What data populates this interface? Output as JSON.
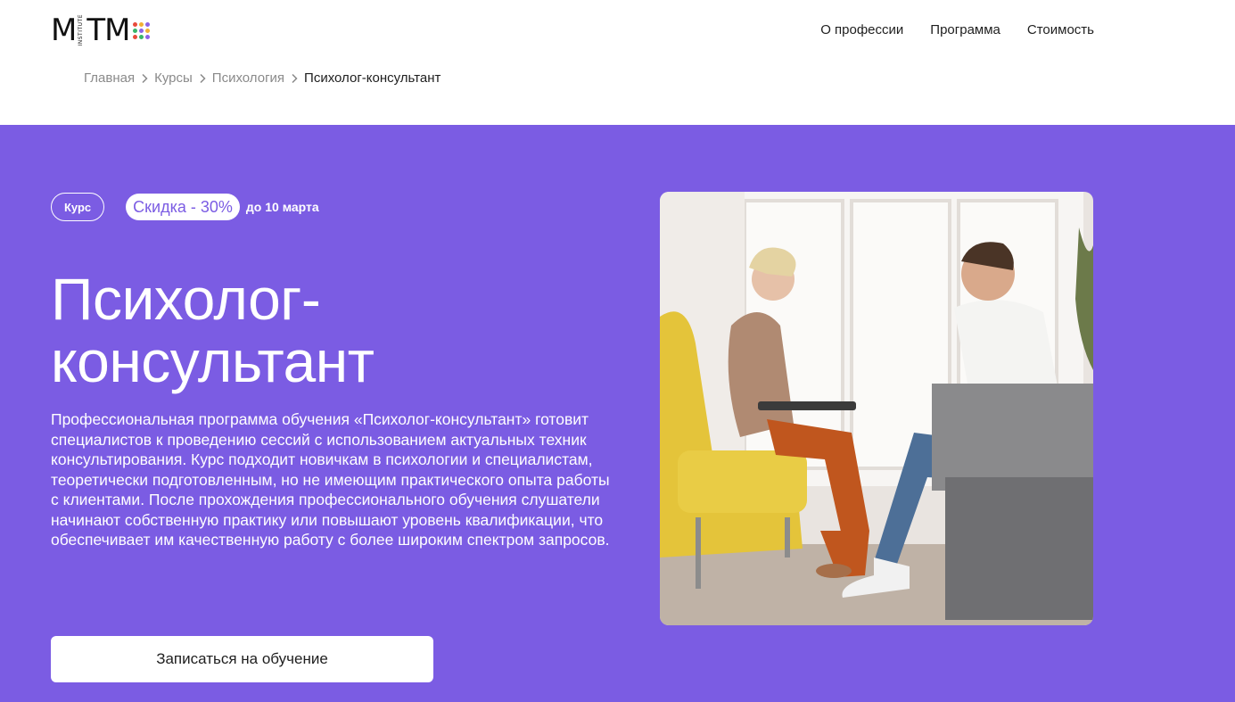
{
  "header": {
    "logo_text_left": "M",
    "logo_sub": "INSTITUTE",
    "logo_text_right": "TM",
    "logo_dot_colors": [
      "#e84b3c",
      "#f2b035",
      "#8e63e6",
      "#39b56a",
      "#8e63e6",
      "#f2b035",
      "#e84b3c",
      "#39b56a",
      "#8e63e6"
    ],
    "nav": [
      {
        "label": "О профессии"
      },
      {
        "label": "Программа"
      },
      {
        "label": "Стоимость"
      }
    ]
  },
  "breadcrumb": [
    {
      "label": "Главная"
    },
    {
      "label": "Курсы"
    },
    {
      "label": "Психология"
    },
    {
      "label": "Психолог-консультант"
    }
  ],
  "hero": {
    "background": "#7b5ce3",
    "badge_course": "Курс",
    "badge_discount": "Скидка - 30%",
    "badge_until": "до 10 марта",
    "title_line1": "Психолог-",
    "title_line2": "консультант",
    "description": "Профессиональная программа обучения «Психолог-консультант» готовит специалистов к проведению сессий с использованием актуальных техник консультирования. Курс подходит новичкам в психологии и специалистам, теоретически подготовленным, но не имеющим практического опыта работы с клиентами. После прохождения профессионального обучения слушатели начинают собственную практику или повышают уровень квалификации, что обеспечивает им качественную работу с более широким спектром запросов.",
    "cta_label": "Записаться на обучение",
    "photo_icon": "consultation-photo"
  }
}
